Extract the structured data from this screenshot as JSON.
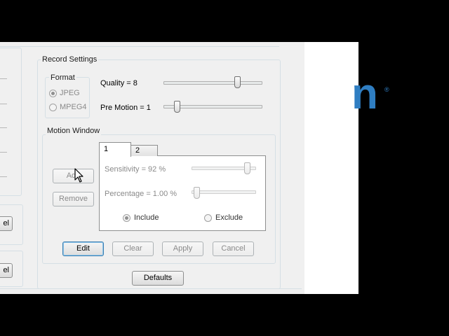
{
  "record_settings": {
    "title": "Record Settings",
    "format": {
      "title": "Format",
      "options": [
        {
          "label": "JPEG",
          "checked": true
        },
        {
          "label": "MPEG4",
          "checked": false
        }
      ]
    },
    "quality_label": "Quality = 8",
    "pre_motion_label": "Pre Motion = 1"
  },
  "motion_window": {
    "title": "Motion Window",
    "tabs": [
      {
        "label": "1"
      },
      {
        "label": "2"
      }
    ],
    "add_label": "Add",
    "remove_label": "Remove",
    "sensitivity_label": "Sensitivity = 92 %",
    "percentage_label": "Percentage = 1.00 %",
    "include_label": "Include",
    "exclude_label": "Exclude",
    "buttons": {
      "edit": "Edit",
      "clear": "Clear",
      "apply": "Apply",
      "cancel": "Cancel"
    }
  },
  "left_fragment_buttons": [
    "el",
    "el"
  ],
  "defaults_label": "Defaults",
  "logo_fragment": "n",
  "colors": {
    "accent": "#2f7ec2",
    "panel": "#f0f0f0"
  }
}
